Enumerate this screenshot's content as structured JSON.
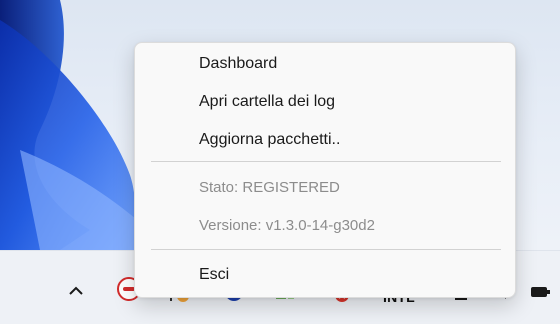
{
  "context_menu": {
    "items": [
      {
        "label": "Dashboard",
        "enabled": true
      },
      {
        "label": "Apri cartella dei log",
        "enabled": true
      },
      {
        "label": "Aggiorna pacchetti..",
        "enabled": true
      }
    ],
    "status": {
      "label": "Stato: REGISTERED",
      "enabled": false
    },
    "version": {
      "label": "Versione: v1.3.0-14-g30d2",
      "enabled": false
    },
    "exit": {
      "label": "Esci",
      "enabled": true
    }
  },
  "taskbar": {
    "language_indicator": "INTL",
    "tray_icons": [
      "show-hidden-icons-chevron",
      "red-app-icon",
      "orange-app-icon",
      "blue-app-icon",
      "green-app-icon",
      "red-error-app-icon",
      "network-icon",
      "volume-icon",
      "battery-icon"
    ]
  },
  "colors": {
    "menu_background": "#f9f9f9",
    "disabled_text": "#8c8c8c",
    "wallpaper_blue": "#1f4fd1"
  }
}
